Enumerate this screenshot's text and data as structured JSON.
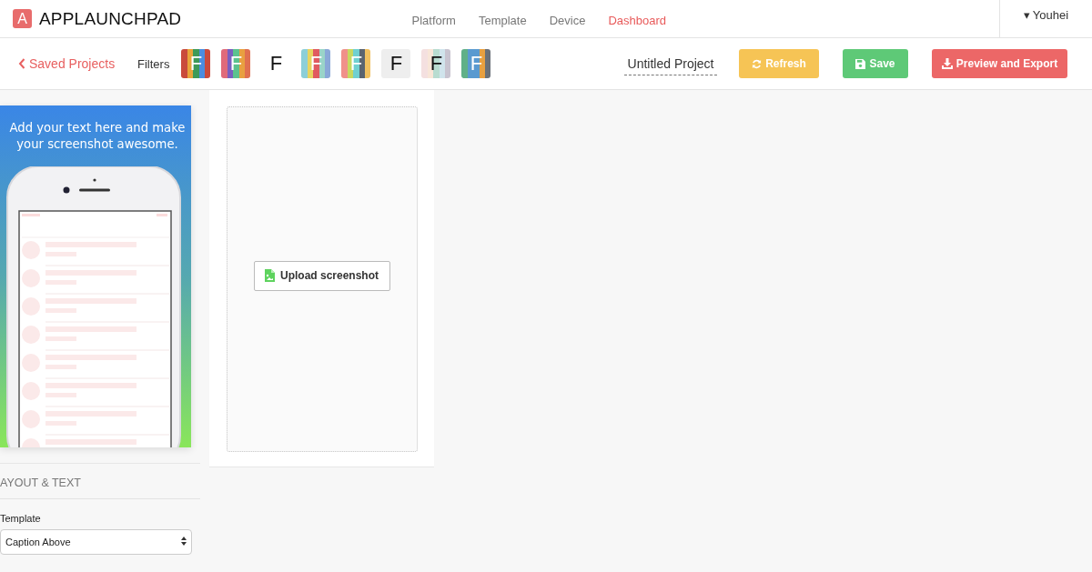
{
  "brand": {
    "logo_letter": "A",
    "name": "APPLAUNCHPAD"
  },
  "nav": [
    {
      "label": "Platform",
      "selected": false
    },
    {
      "label": "Template",
      "selected": false
    },
    {
      "label": "Device",
      "selected": false
    },
    {
      "label": "Dashboard",
      "selected": true
    }
  ],
  "user": {
    "caret": "▾",
    "name": "Youhei"
  },
  "toolbar": {
    "back": "Saved Projects",
    "filters_label": "Filters",
    "filters": [
      {
        "letter": "F",
        "dark_letter": false,
        "stripes": [
          {
            "color": "#c94a3c"
          },
          {
            "color": "#e8a43a"
          },
          {
            "color": "#3e9a58"
          },
          {
            "color": "#4a8de0"
          },
          {
            "color": "#c94a3c"
          }
        ]
      },
      {
        "letter": "F",
        "dark_letter": false,
        "stripes": [
          {
            "color": "#e06a7a"
          },
          {
            "color": "#7a5fc0"
          },
          {
            "color": "#5cc28e"
          },
          {
            "color": "#e8a040"
          },
          {
            "color": "#e07050"
          }
        ]
      },
      {
        "letter": "F",
        "dark_letter": true
      },
      {
        "letter": "F",
        "dark_letter": false,
        "stripes": [
          {
            "color": "#8ccfd8"
          },
          {
            "color": "#e8d460"
          },
          {
            "color": "#e05a60"
          },
          {
            "color": "#9ad4c8"
          },
          {
            "color": "#8aa8d8"
          }
        ]
      },
      {
        "letter": "F",
        "dark_letter": false,
        "stripes": [
          {
            "color": "#f0908a"
          },
          {
            "color": "#c8d860"
          },
          {
            "color": "#70d0d0"
          },
          {
            "color": "#5a6470"
          },
          {
            "color": "#f0c060"
          }
        ]
      },
      {
        "letter": "F",
        "dark_letter": true,
        "stripes": [
          {
            "color": "#eeeeee"
          }
        ]
      },
      {
        "letter": "F",
        "dark_letter": true,
        "stripes": [
          {
            "color": "#f4e0e0"
          },
          {
            "color": "#f8e6d8"
          },
          {
            "color": "#b8dcd0"
          },
          {
            "color": "#d0e4ec"
          },
          {
            "color": "#c8c4d0"
          }
        ]
      },
      {
        "letter": "F",
        "dark_letter": false,
        "stripes": [
          {
            "color": "#60b088"
          },
          {
            "color": "#5a9ad0"
          },
          {
            "color": "#5a9ad0"
          },
          {
            "color": "#e8a040"
          },
          {
            "color": "#6a7078"
          }
        ]
      }
    ],
    "project_name": "Untitled Project",
    "buttons": [
      {
        "kind": "refresh",
        "label": "Refresh"
      },
      {
        "kind": "save",
        "label": "Save"
      },
      {
        "kind": "export",
        "label": "Preview and Export"
      }
    ]
  },
  "preview": {
    "caption": "Add your text here and make your screenshot awesome."
  },
  "upload": {
    "label": "Upload screenshot"
  },
  "settings": {
    "section": "AYOUT & TEXT",
    "template_label": "Template",
    "template_value": "Caption Above"
  }
}
